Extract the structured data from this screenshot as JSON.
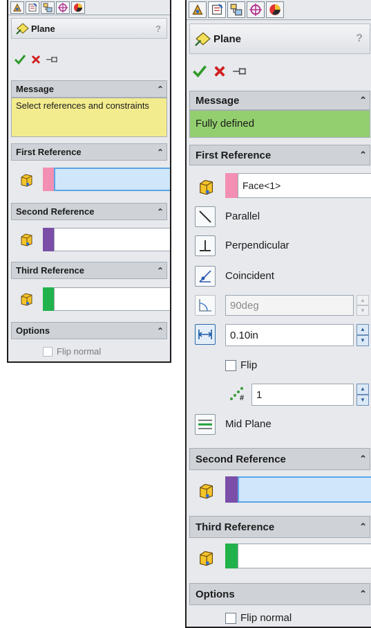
{
  "colors": {
    "message_warning": "#f3ec8e",
    "message_ok": "#93cf6e",
    "first_ref": "#f28fb2",
    "second_ref": "#7b4fa8",
    "third_ref": "#22b24c",
    "selected_field": "#cfe6fb"
  },
  "tab_icons": [
    "feature-manager-icon",
    "property-manager-icon",
    "configuration-manager-icon",
    "dimxpert-icon",
    "display-manager-icon"
  ],
  "left": {
    "title": "Plane",
    "help": "?",
    "message": {
      "header": "Message",
      "text": "Select references and constraints",
      "state": "warning"
    },
    "first_reference": {
      "header": "First Reference",
      "value": "",
      "selected": true
    },
    "second_reference": {
      "header": "Second Reference",
      "value": ""
    },
    "third_reference": {
      "header": "Third Reference",
      "value": ""
    },
    "options": {
      "header": "Options",
      "flip_normal": "Flip normal",
      "flip_normal_checked": false,
      "flip_normal_enabled": false
    }
  },
  "right": {
    "title": "Plane",
    "help": "?",
    "message": {
      "header": "Message",
      "text": "Fully defined",
      "state": "ok"
    },
    "first_reference": {
      "header": "First Reference",
      "value": "Face<1>",
      "constraints": {
        "parallel": "Parallel",
        "perpendicular": "Perpendicular",
        "coincident": "Coincident",
        "angle": "90deg",
        "distance": "0.10in",
        "flip": "Flip",
        "flip_checked": false,
        "instances": "1",
        "mid_plane": "Mid Plane"
      }
    },
    "second_reference": {
      "header": "Second Reference",
      "value": "",
      "selected": true
    },
    "third_reference": {
      "header": "Third Reference",
      "value": ""
    },
    "options": {
      "header": "Options",
      "flip_normal": "Flip normal",
      "flip_normal_checked": false
    }
  }
}
